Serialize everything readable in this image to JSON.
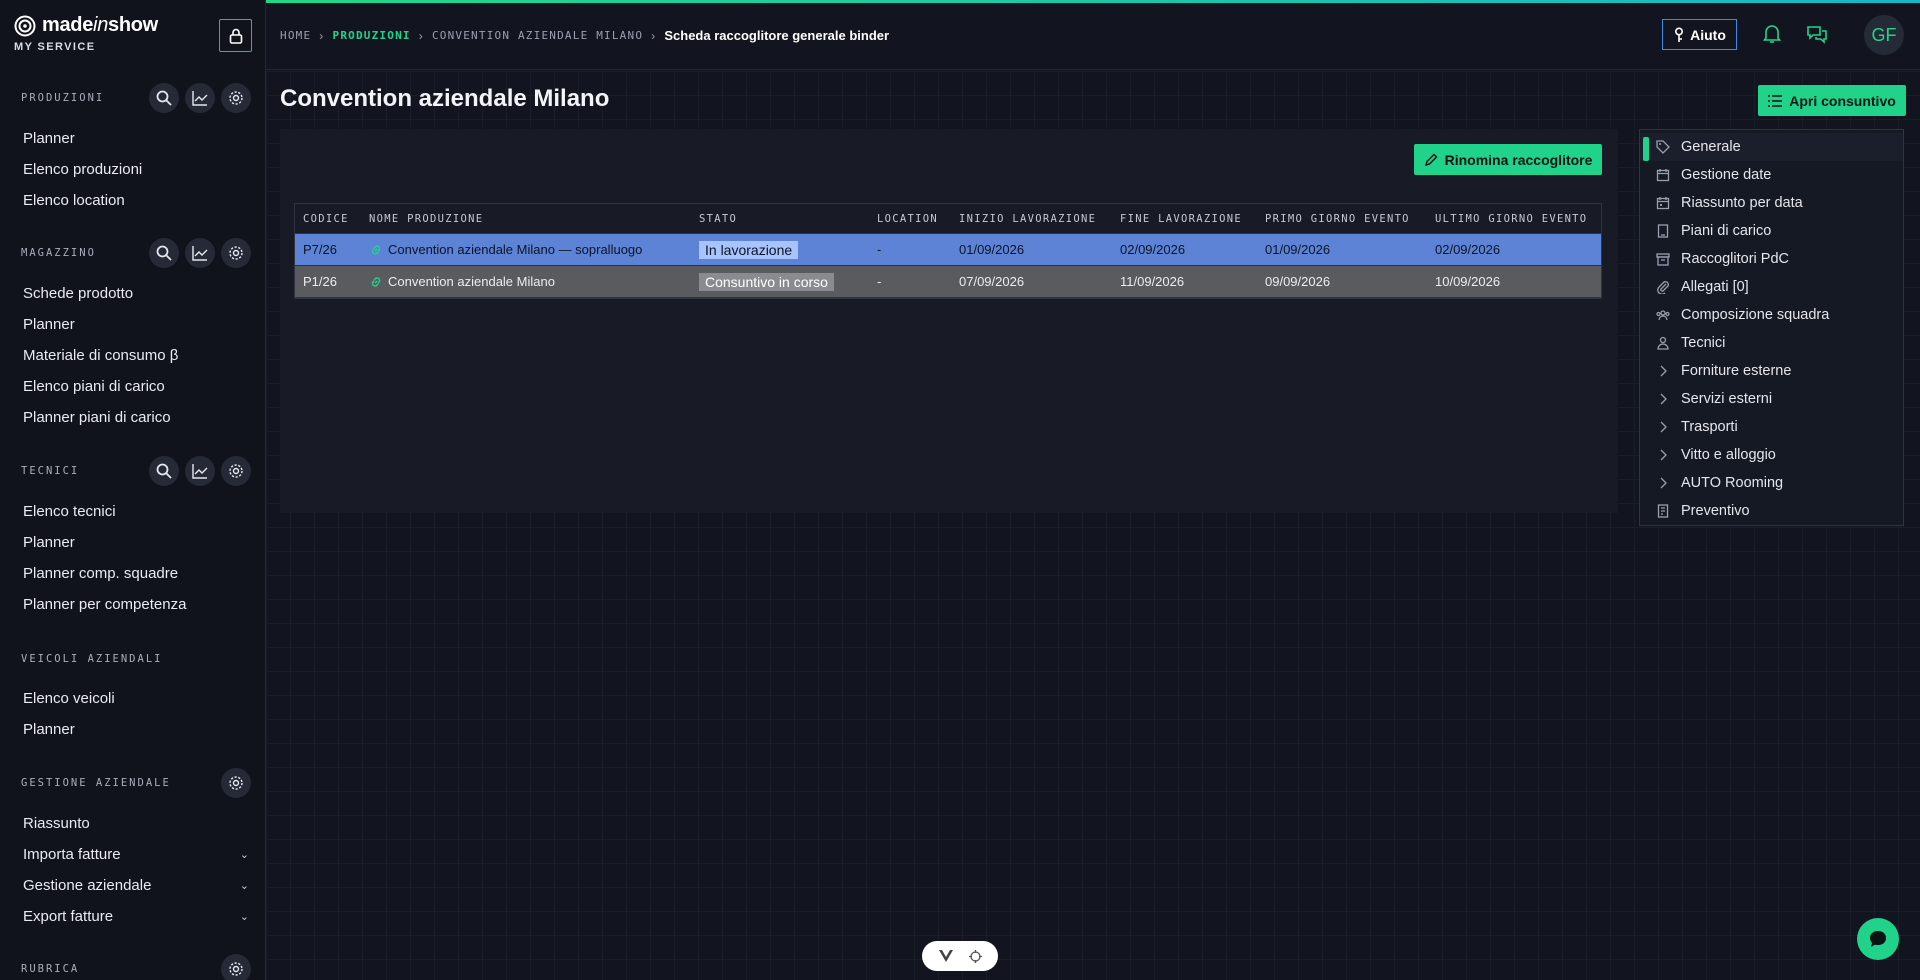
{
  "brand": {
    "name_prefix": "made",
    "name_italic": "in",
    "name_suffix": "show",
    "subtitle": "MY SERVICE"
  },
  "sidebar": {
    "sections": [
      {
        "title": "PRODUZIONI",
        "items": [
          "Planner",
          "Elenco produzioni",
          "Elenco location"
        ]
      },
      {
        "title": "MAGAZZINO",
        "items": [
          "Schede prodotto",
          "Planner",
          "Materiale di consumo β",
          "Elenco piani di carico",
          "Planner piani di carico"
        ]
      },
      {
        "title": "TECNICI",
        "items": [
          "Elenco tecnici",
          "Planner",
          "Planner comp. squadre",
          "Planner per competenza"
        ]
      },
      {
        "title": "VEICOLI AZIENDALI",
        "items": [
          "Elenco veicoli",
          "Planner"
        ]
      },
      {
        "title": "GESTIONE AZIENDALE",
        "items": [
          "Riassunto",
          "Importa fatture",
          "Gestione aziendale",
          "Export fatture"
        ]
      },
      {
        "title": "RUBRICA",
        "items": []
      }
    ]
  },
  "topbar": {
    "breadcrumb": [
      "HOME",
      "PRODUZIONI",
      "CONVENTION AZIENDALE MILANO",
      "Scheda raccoglitore generale binder"
    ],
    "help_label": "Aiuto",
    "avatar_initials": "GF"
  },
  "main": {
    "title": "Convention aziendale Milano",
    "open_button": "Apri consuntivo",
    "rename_button": "Rinomina raccoglitore",
    "table": {
      "columns": [
        "CODICE",
        "NOME PRODUZIONE",
        "STATO",
        "LOCATION",
        "INIZIO LAVORAZIONE",
        "FINE LAVORAZIONE",
        "PRIMO GIORNO EVENTO",
        "ULTIMO GIORNO EVENTO"
      ],
      "rows": [
        {
          "code": "P7/26",
          "name": "Convention aziendale Milano — sopralluogo",
          "status": "In lavorazione",
          "location": "-",
          "start": "01/09/2026",
          "end": "02/09/2026",
          "first_day": "01/09/2026",
          "last_day": "02/09/2026"
        },
        {
          "code": "P1/26",
          "name": "Convention aziendale Milano",
          "status": "Consuntivo in corso",
          "location": "-",
          "start": "07/09/2026",
          "end": "11/09/2026",
          "first_day": "09/09/2026",
          "last_day": "10/09/2026"
        }
      ]
    },
    "side_menu": [
      {
        "label": "Generale",
        "icon": "tag-icon"
      },
      {
        "label": "Gestione date",
        "icon": "calendar-icon"
      },
      {
        "label": "Riassunto per data",
        "icon": "calendar-summary-icon"
      },
      {
        "label": "Piani di carico",
        "icon": "document-icon"
      },
      {
        "label": "Raccoglitori PdC",
        "icon": "archive-icon"
      },
      {
        "label": "Allegati [0]",
        "icon": "paperclip-icon"
      },
      {
        "label": "Composizione squadra",
        "icon": "team-icon"
      },
      {
        "label": "Tecnici",
        "icon": "person-icon"
      },
      {
        "label": "Forniture esterne",
        "icon": "chevron-right-icon"
      },
      {
        "label": "Servizi esterni",
        "icon": "chevron-right-icon"
      },
      {
        "label": "Trasporti",
        "icon": "chevron-right-icon"
      },
      {
        "label": "Vitto e alloggio",
        "icon": "chevron-right-icon"
      },
      {
        "label": "AUTO Rooming",
        "icon": "chevron-right-icon"
      },
      {
        "label": "Preventivo",
        "icon": "invoice-icon"
      }
    ]
  },
  "colors": {
    "accent": "#21d38a",
    "selected_row": "#5c83d6",
    "help_border": "#3d89e6"
  }
}
